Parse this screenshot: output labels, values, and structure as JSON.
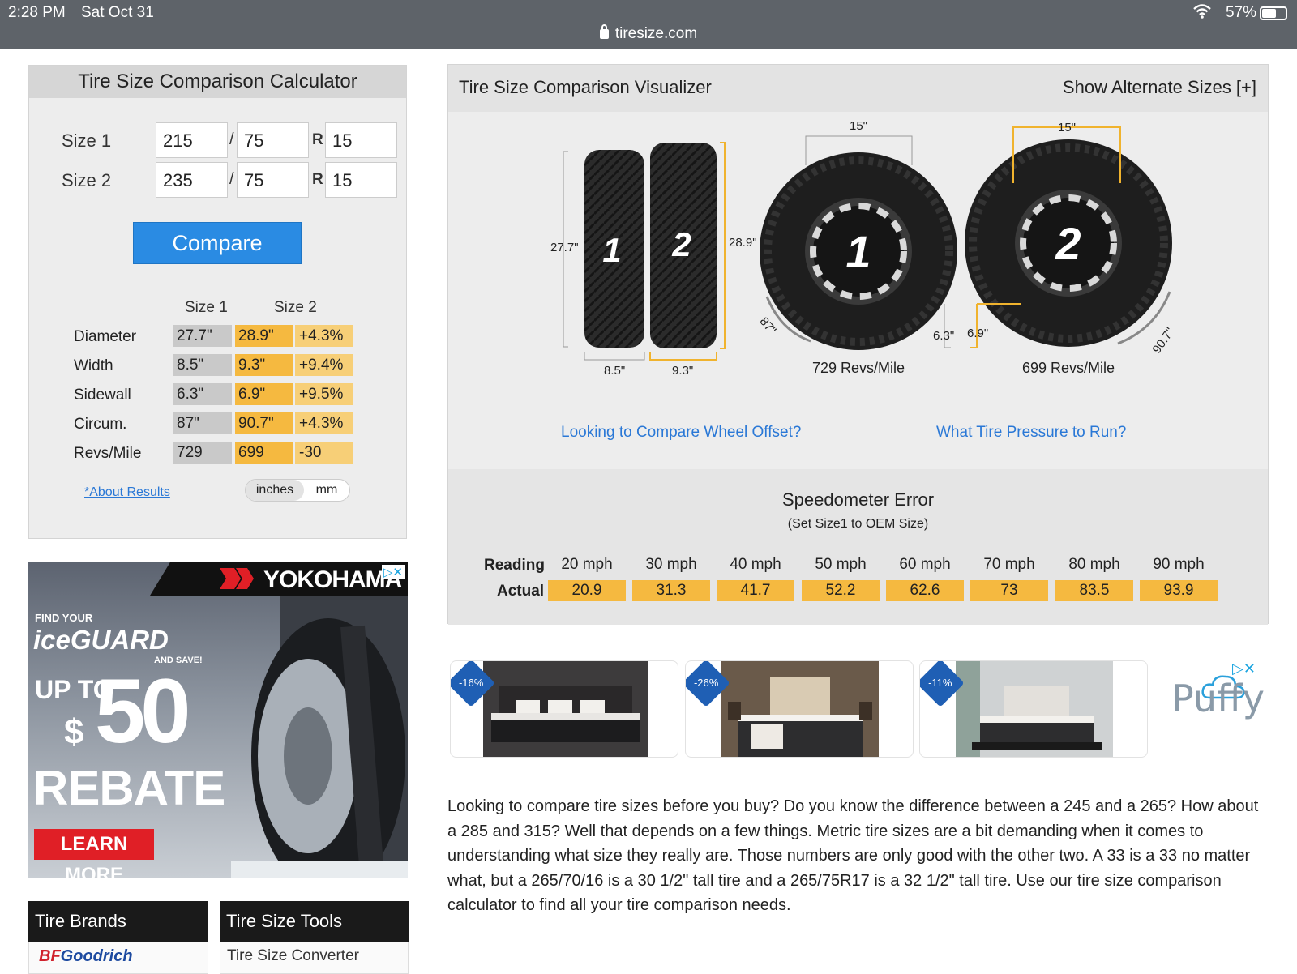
{
  "status": {
    "time": "2:28 PM",
    "date": "Sat Oct 31",
    "url": "tiresize.com",
    "battery": "57%"
  },
  "calculator": {
    "title": "Tire Size Comparison Calculator",
    "size1": {
      "label": "Size 1",
      "width": "215",
      "ratio": "75",
      "r": "R",
      "rim": "15"
    },
    "size2": {
      "label": "Size 2",
      "width": "235",
      "ratio": "75",
      "r": "R",
      "rim": "15"
    },
    "slash": "/",
    "compare": "Compare",
    "head1": "Size 1",
    "head2": "Size 2",
    "rows": [
      {
        "name": "Diameter",
        "s1": "27.7\"",
        "s2": "28.9\"",
        "diff": "+4.3%"
      },
      {
        "name": "Width",
        "s1": "8.5\"",
        "s2": "9.3\"",
        "diff": "+9.4%"
      },
      {
        "name": "Sidewall",
        "s1": "6.3\"",
        "s2": "6.9\"",
        "diff": "+9.5%"
      },
      {
        "name": "Circum.",
        "s1": "87\"",
        "s2": "90.7\"",
        "diff": "+4.3%"
      },
      {
        "name": "Revs/Mile",
        "s1": "729",
        "s2": "699",
        "diff": "-30"
      }
    ],
    "about": "*About Results",
    "unit_on": "inches",
    "unit_off": "mm"
  },
  "ad_left": {
    "brand": "YOKOHAMA",
    "find": "FIND YOUR",
    "product": "iceGUARD",
    "and_save": "AND SAVE!",
    "up_to": "UP TO",
    "dollar": "$",
    "amount": "50",
    "rebate": "REBATE",
    "cta": "LEARN MORE",
    "choices": "▷✕"
  },
  "tabs": {
    "brands": "Tire Brands",
    "tools": "Tire Size Tools",
    "brand_first_a": "BF",
    "brand_first_b": "Goodrich",
    "tool_first": "Tire Size Converter"
  },
  "visualizer": {
    "title": "Tire Size Comparison Visualizer",
    "alt": "Show Alternate Sizes [+]",
    "side": {
      "dia1": "27.7\"",
      "dia2": "28.9\"",
      "w1": "8.5\"",
      "w2": "9.3\"",
      "n1": "1",
      "n2": "2"
    },
    "front": {
      "rim1": "15\"",
      "rim2": "15\"",
      "circ1": "87\"",
      "circ2": "90.7\"",
      "side1": "6.3\"",
      "side2": "6.9\"",
      "revs1": "729 Revs/Mile",
      "revs2": "699 Revs/Mile",
      "n1": "1",
      "n2": "2"
    },
    "link_offset": "Looking to Compare Wheel Offset?",
    "link_pressure": "What Tire Pressure to Run?",
    "speedo": {
      "title": "Speedometer Error",
      "subtitle": "(Set Size1 to OEM Size)",
      "reading_label": "Reading",
      "actual_label": "Actual",
      "readings": [
        "20 mph",
        "30 mph",
        "40 mph",
        "50 mph",
        "60 mph",
        "70 mph",
        "80 mph",
        "90 mph"
      ],
      "actuals": [
        "20.9",
        "31.3",
        "41.7",
        "52.2",
        "62.6",
        "73",
        "83.5",
        "93.9"
      ]
    }
  },
  "ad_row": {
    "discounts": [
      "-16%",
      "-26%",
      "-11%"
    ],
    "brand": "Puffy",
    "choices": "▷✕"
  },
  "paragraph": "Looking to compare tire sizes before you buy? Do you know the difference between a 245 and a 265? How about a 285 and 315? Well that depends on a few things. Metric tire sizes are a bit demanding when it comes to understanding what size they really are. Those numbers are only good with the other two. A 33 is a 33 no matter what, but a 265/70/16 is a 30 1/2\" tall tire and a 265/75R17 is a 32 1/2\" tall tire. Use our tire size comparison calculator to find all your tire comparison needs.",
  "colors": {
    "accent": "#2a8be3",
    "size2": "#f5b940",
    "size1": "#c9c9c9",
    "link": "#2a78d6",
    "statusbar": "#5e6369"
  }
}
